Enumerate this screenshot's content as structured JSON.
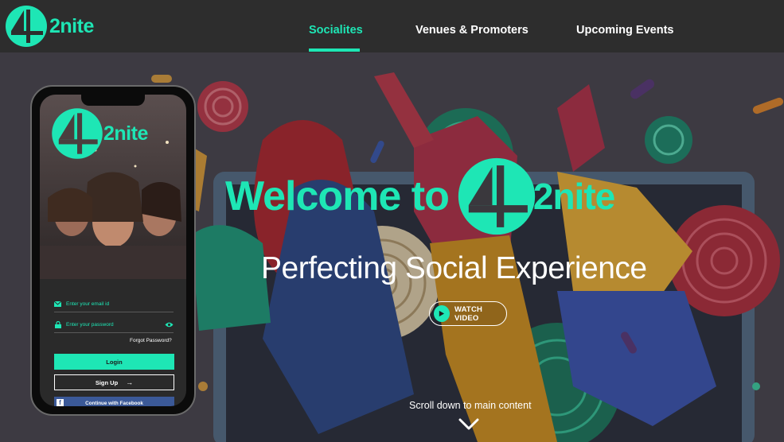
{
  "brand": {
    "logo_mark": "4",
    "logo_text": "2nite",
    "accent_color": "#1ee6b5",
    "nav_bg_color": "#2d2d2d"
  },
  "nav": {
    "items": [
      {
        "label": "Socialites",
        "active": true
      },
      {
        "label": "Venues & Promoters",
        "active": false
      },
      {
        "label": "Upcoming Events",
        "active": false
      }
    ]
  },
  "hero": {
    "welcome_text": "Welcome to",
    "welcome_logo_text": "2nite",
    "tagline": "Perfecting Social Experience",
    "watch_video_label": "WATCH VIDEO",
    "scroll_text": "Scroll down to main content"
  },
  "phone": {
    "logo_text": "2nite",
    "email_placeholder": "Enter your email id",
    "password_placeholder": "Enter your password",
    "forgot_password": "Forgot Password?",
    "login_label": "Login",
    "signup_label": "Sign Up",
    "signup_arrow": "→",
    "facebook_label": "Continue with Facebook",
    "facebook_icon_glyph": "f"
  },
  "icons": [
    "play-icon",
    "chevron-down-icon",
    "mail-icon",
    "lock-icon",
    "eye-icon",
    "arrow-right-icon",
    "facebook-icon"
  ]
}
